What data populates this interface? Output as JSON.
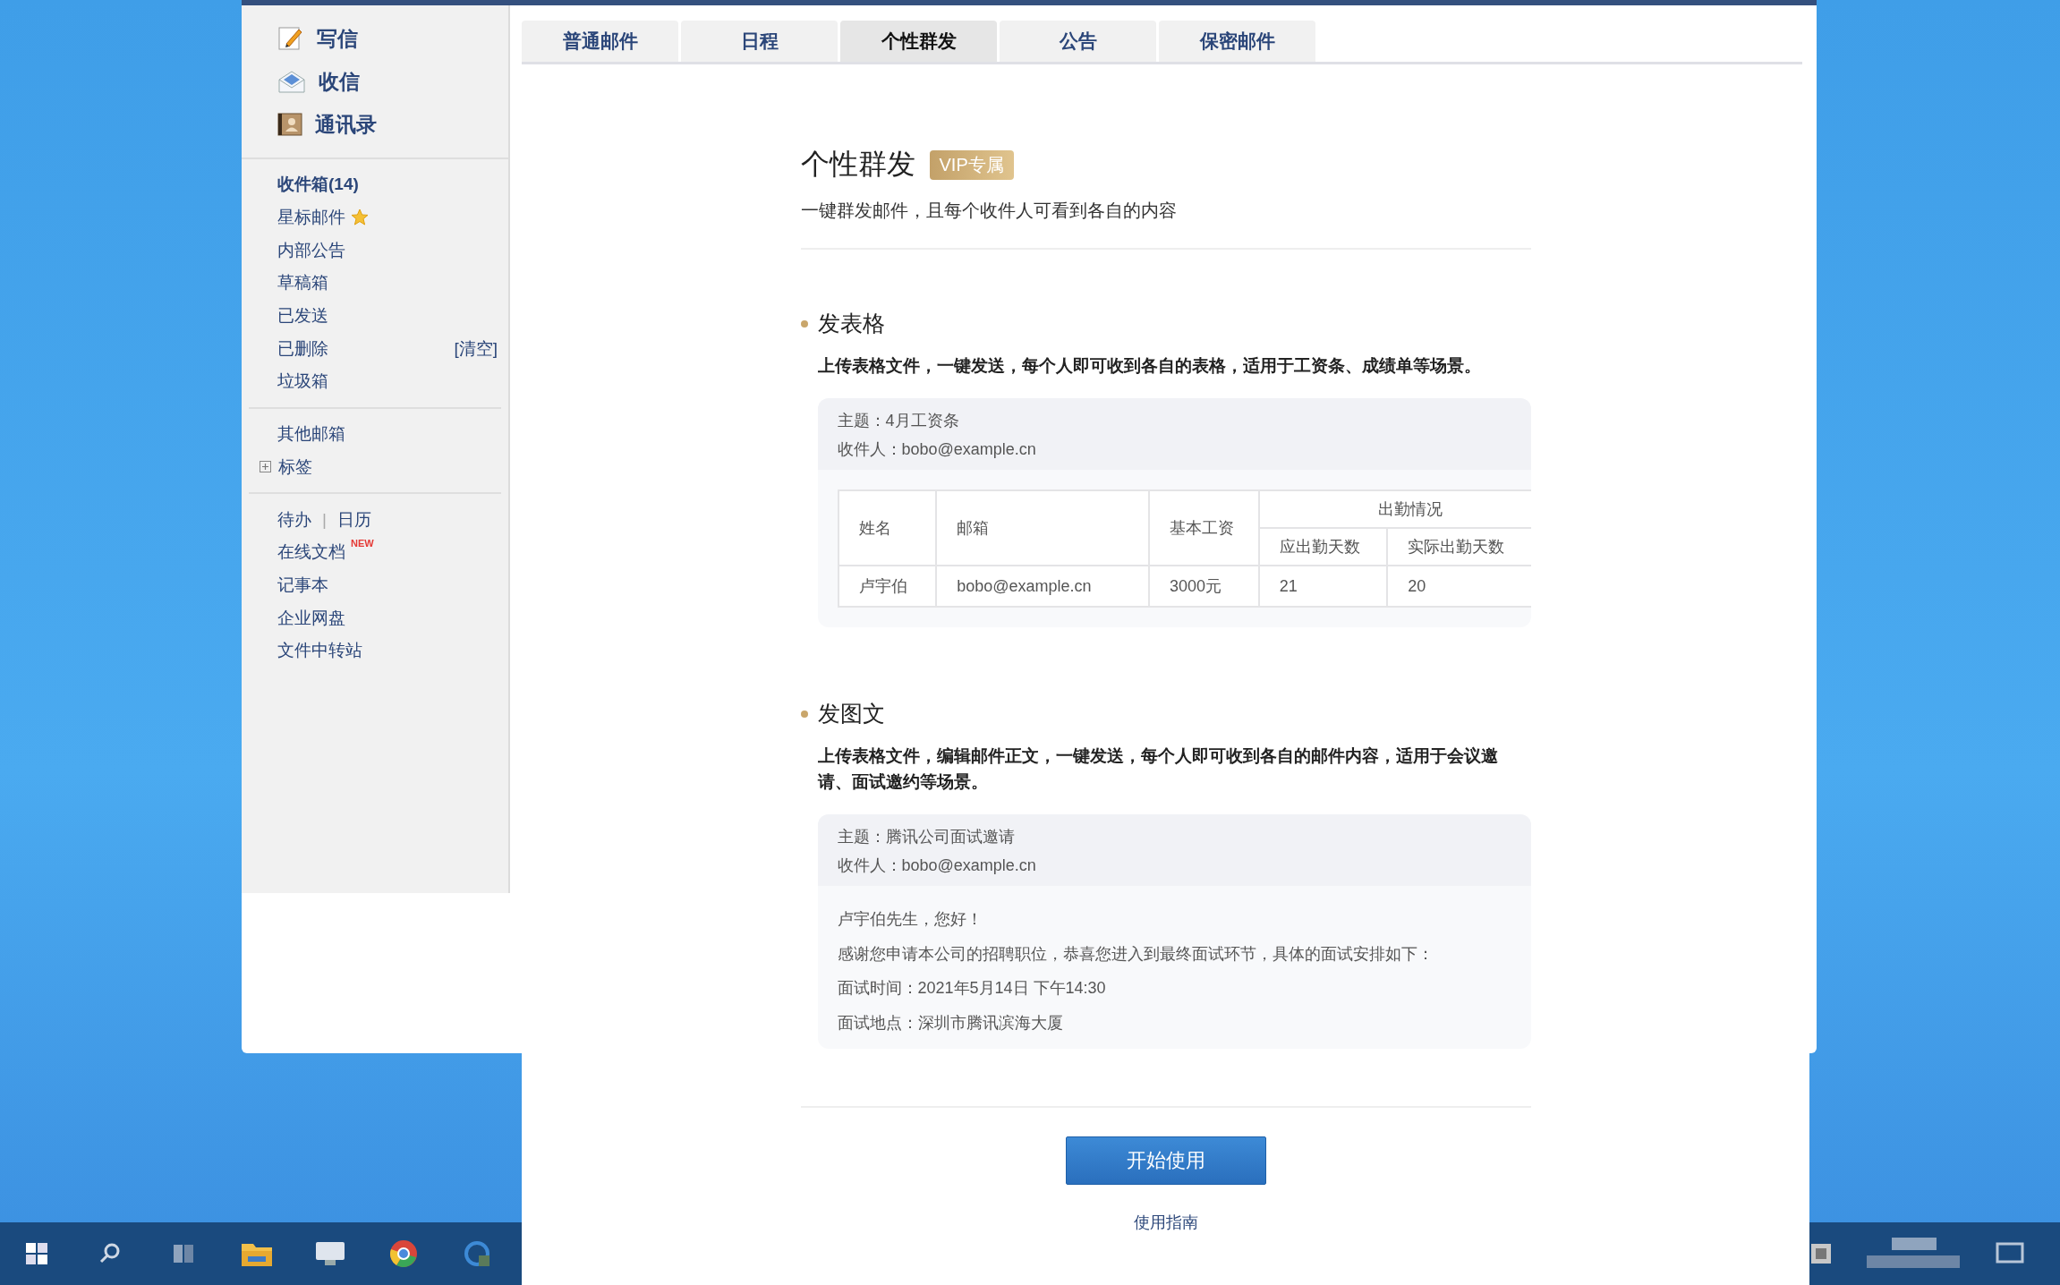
{
  "sidebar": {
    "primary": [
      {
        "label": "写信"
      },
      {
        "label": "收信"
      },
      {
        "label": "通讯录"
      }
    ],
    "folders": [
      {
        "label": "收件箱(14)",
        "kind": "unread"
      },
      {
        "label": "星标邮件",
        "kind": "starred"
      },
      {
        "label": "内部公告",
        "kind": "plain"
      },
      {
        "label": "草稿箱",
        "kind": "plain"
      },
      {
        "label": "已发送",
        "kind": "plain"
      },
      {
        "label": "已删除",
        "kind": "plain",
        "action": "[清空]"
      },
      {
        "label": "垃圾箱",
        "kind": "plain"
      }
    ],
    "other": [
      {
        "label": "其他邮箱",
        "kind": "plain"
      },
      {
        "label": "标签",
        "kind": "expandable",
        "expanded": false
      }
    ],
    "tools": [
      {
        "labels": [
          "待办",
          "日历"
        ],
        "separator": "|"
      },
      {
        "labels": [
          "在线文档"
        ],
        "badge": "NEW"
      },
      {
        "labels": [
          "记事本"
        ]
      },
      {
        "labels": [
          "企业网盘"
        ]
      },
      {
        "labels": [
          "文件中转站"
        ]
      }
    ]
  },
  "tabs": [
    {
      "label": "普通邮件",
      "selected": false
    },
    {
      "label": "日程",
      "selected": false
    },
    {
      "label": "个性群发",
      "selected": true
    },
    {
      "label": "公告",
      "selected": false
    },
    {
      "label": "保密邮件",
      "selected": false
    }
  ],
  "intro": {
    "title": "个性群发",
    "badge": "VIP专属",
    "subtitle": "一键群发邮件，且每个收件人可看到各自的内容"
  },
  "sections": [
    {
      "title": "发表格",
      "description": "上传表格文件，一键发送，每个人即可收到各自的表格，适用于工资条、成绩单等场景。",
      "example": {
        "kind": "table",
        "subject": "主题：4月工资条",
        "recipient": "收件人：bobo@example.cn",
        "header_rows": [
          [
            {
              "label": "姓名",
              "rowspan": 2
            },
            {
              "label": "邮箱",
              "rowspan": 2
            },
            {
              "label": "基本工资",
              "rowspan": 2
            },
            {
              "label": "出勤情况",
              "colspan": 2
            }
          ],
          [
            {
              "label": "应出勤天数"
            },
            {
              "label": "实际出勤天数"
            }
          ]
        ],
        "rows": [
          [
            "卢宇伯",
            "bobo@example.cn",
            "3000元",
            "21",
            "20"
          ]
        ]
      }
    },
    {
      "title": "发图文",
      "description": "上传表格文件，编辑邮件正文，一键发送，每个人即可收到各自的邮件内容，适用于会议邀请、面试邀约等场景。",
      "example": {
        "kind": "letter",
        "subject": "主题：腾讯公司面试邀请",
        "recipient": "收件人：bobo@example.cn",
        "lines": [
          "卢宇伯先生，您好！",
          "感谢您申请本公司的招聘职位，恭喜您进入到最终面试环节，具体的面试安排如下：",
          "面试时间：2021年5月14日 下午14:30",
          "面试地点：深圳市腾讯滨海大厦"
        ]
      }
    }
  ],
  "start_button": "开始使用",
  "guide_link": "使用指南"
}
